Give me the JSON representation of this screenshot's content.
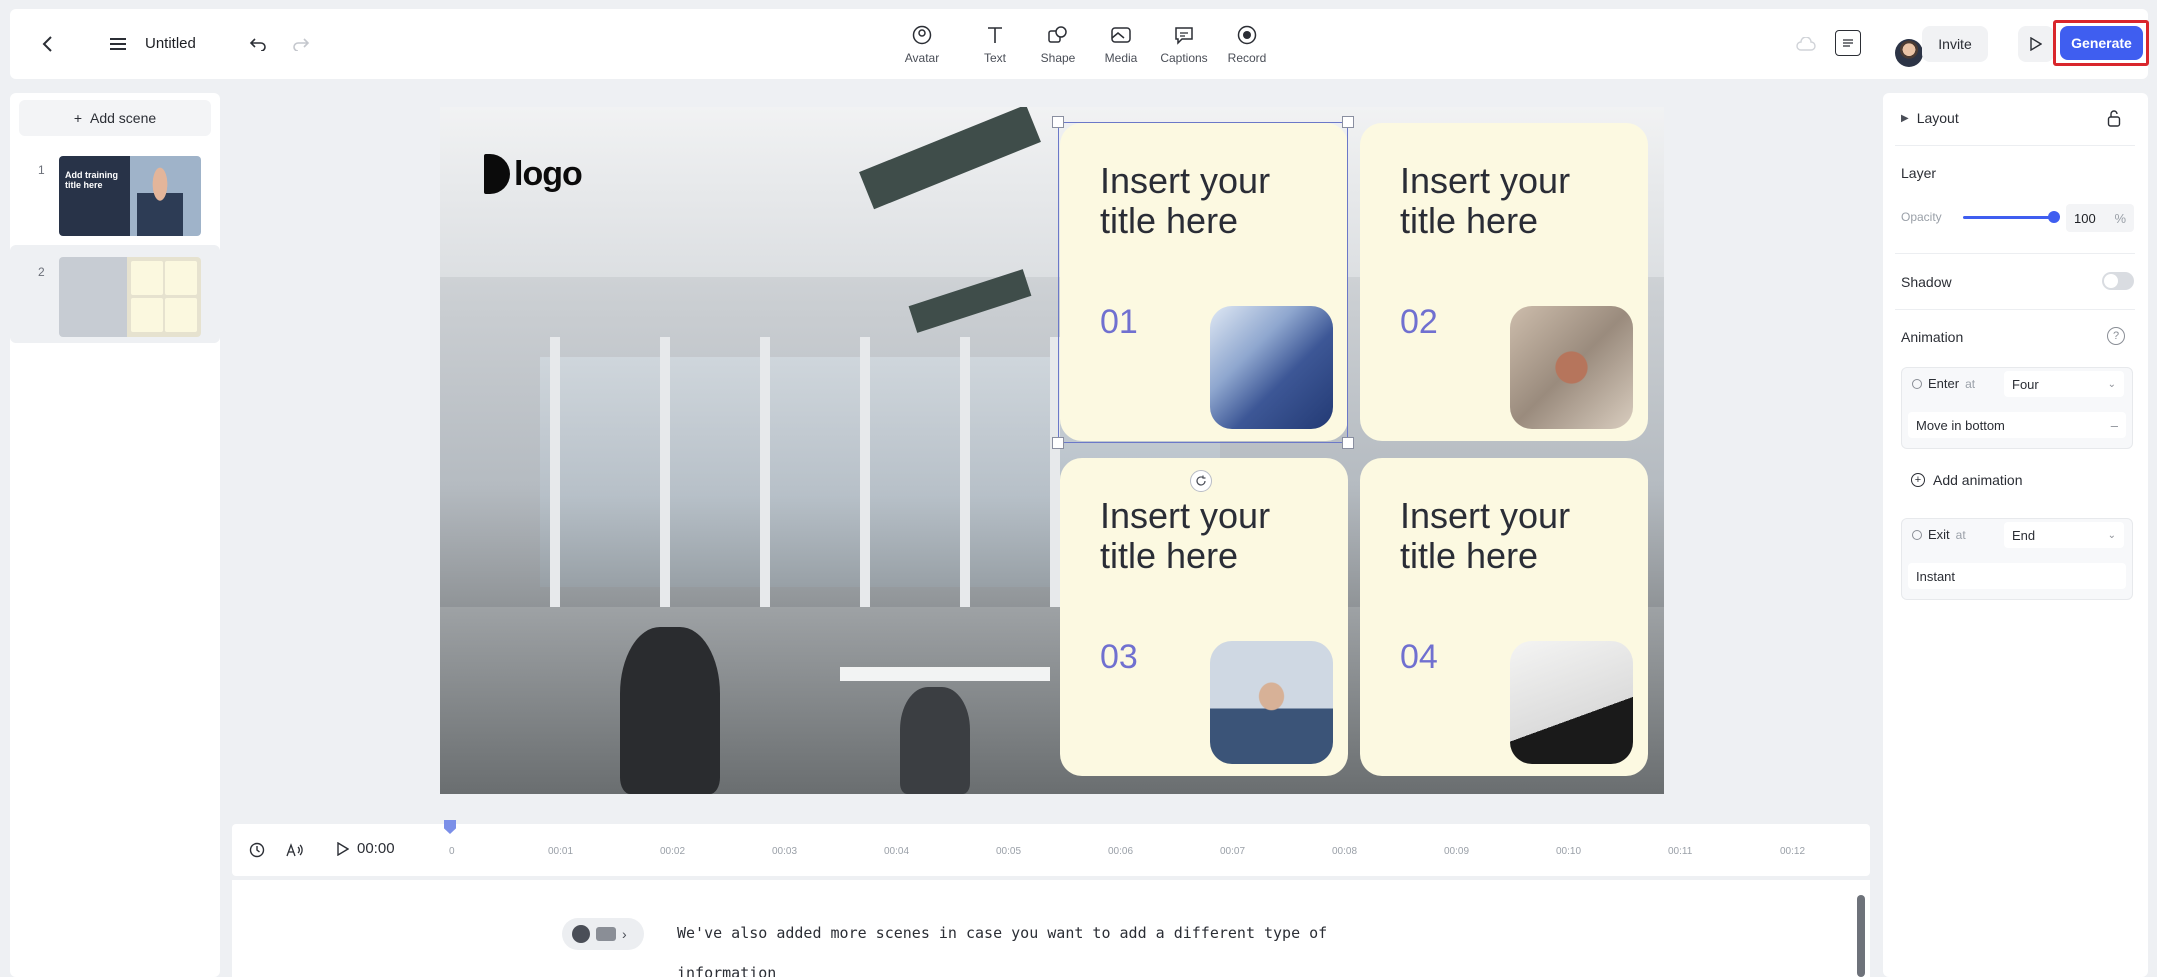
{
  "topbar": {
    "doc_title": "Untitled",
    "tools": [
      {
        "label": "Avatar",
        "icon": "avatar-icon"
      },
      {
        "label": "Text",
        "icon": "text-icon"
      },
      {
        "label": "Shape",
        "icon": "shape-icon"
      },
      {
        "label": "Media",
        "icon": "media-icon"
      },
      {
        "label": "Captions",
        "icon": "captions-icon"
      },
      {
        "label": "Record",
        "icon": "record-icon"
      }
    ],
    "invite_label": "Invite",
    "generate_label": "Generate",
    "accent_color": "#3f5ef0"
  },
  "scenes": {
    "add_label": "Add scene",
    "items": [
      {
        "num": "1",
        "thumb_text": "Add training title here"
      },
      {
        "num": "2"
      }
    ]
  },
  "canvas": {
    "logo_text": "logo",
    "cards": [
      {
        "title": "Insert your title here",
        "num": "01"
      },
      {
        "title": "Insert your title here",
        "num": "02"
      },
      {
        "title": "Insert your title here",
        "num": "03"
      },
      {
        "title": "Insert your title here",
        "num": "04"
      }
    ]
  },
  "timeline": {
    "current_time": "00:00",
    "ticks": [
      "0",
      "00:01",
      "00:02",
      "00:03",
      "00:04",
      "00:05",
      "00:06",
      "00:07",
      "00:08",
      "00:09",
      "00:10",
      "00:11",
      "00:12"
    ]
  },
  "script": {
    "line1": "We've also added more scenes in case you want to add a different type of",
    "line2": "information"
  },
  "rightpanel": {
    "layout_label": "Layout",
    "layer_label": "Layer",
    "opacity_label": "Opacity",
    "opacity_value": "100",
    "opacity_unit": "%",
    "shadow_label": "Shadow",
    "animation_label": "Animation",
    "enter_label": "Enter",
    "at_label": "at",
    "enter_at": "Four",
    "enter_effect": "Move in bottom",
    "add_animation_label": "Add animation",
    "exit_label": "Exit",
    "exit_at": "End",
    "exit_effect": "Instant"
  }
}
